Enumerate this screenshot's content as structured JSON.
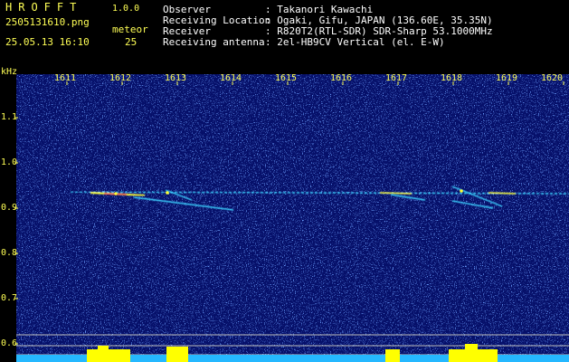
{
  "header": {
    "app_title": "HROFFT",
    "app_version": "1.0.0",
    "file_name": "2505131610.png",
    "date_time": "25.05.13 16:10",
    "meteor_label": "meteor",
    "meteor_count": "25"
  },
  "info": [
    {
      "key": "Observer",
      "value": ": Takanori Kawachi"
    },
    {
      "key": "Receiving Location",
      "value": ": Ogaki, Gifu, JAPAN (136.60E, 35.35N)"
    },
    {
      "key": "Receiver",
      "value": ": R820T2(RTL-SDR) SDR-Sharp 53.1000MHz"
    },
    {
      "key": "Receiving antenna",
      "value": ": 2el-HB9CV Vertical (el. E-W)"
    }
  ],
  "axis": {
    "y_unit": "kHz",
    "x_ticks": [
      "1611",
      "1612",
      "1613",
      "1614",
      "1615",
      "1616",
      "1617",
      "1618",
      "1619",
      "1620"
    ],
    "y_ticks": [
      "1.1",
      "1.0",
      "0.9",
      "0.8",
      "0.7",
      "0.6"
    ]
  },
  "colors": {
    "label": "#ffff55",
    "text": "#ffffff",
    "background": "#06106a",
    "trace": "#3ad1ff",
    "hot": "#ffff33",
    "meter": "#25b8ff",
    "meter_peak": "#ffff00"
  }
}
